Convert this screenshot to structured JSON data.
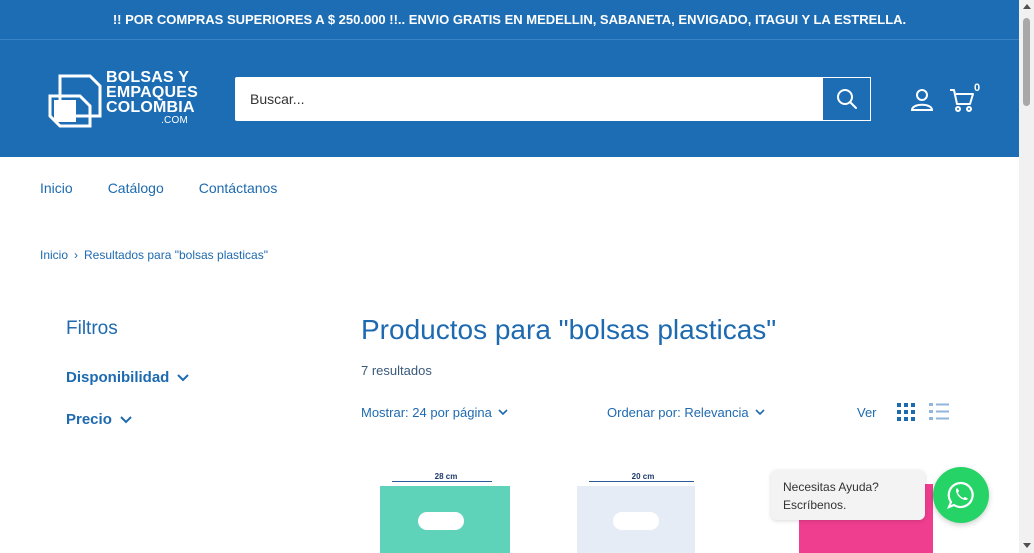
{
  "announcement": "!! POR COMPRAS SUPERIORES A $ 250.000 !!.. ENVIO GRATIS EN MEDELLIN, SABANETA, ENVIGADO, ITAGUI Y LA ESTRELLA.",
  "brand": {
    "line1": "BOLSAS Y",
    "line2": "EMPAQUES",
    "line3": "COLOMBIA",
    "suffix": ".COM"
  },
  "search": {
    "placeholder": "Buscar..."
  },
  "cart": {
    "count": "0"
  },
  "nav": [
    "Inicio",
    "Catálogo",
    "Contáctanos"
  ],
  "breadcrumb": {
    "home": "Inicio",
    "separator": "›",
    "current": "Resultados para \"bolsas plasticas\""
  },
  "filters": {
    "title": "Filtros",
    "items": [
      "Disponibilidad",
      "Precio"
    ]
  },
  "results": {
    "title": "Productos para \"bolsas plasticas\"",
    "count": "7 resultados"
  },
  "toolbar": {
    "show": "Mostrar: 24 por página",
    "sort": "Ordenar por: Relevancia",
    "view": "Ver"
  },
  "products": [
    {
      "dimension": "28 cm",
      "color": "#5fd3b9"
    },
    {
      "dimension": "20 cm",
      "color": "#e6ecf6"
    },
    {
      "dimension": "",
      "color": "#ef3e8f"
    }
  ],
  "chat": {
    "line1": "Necesitas Ayuda?",
    "line2": "Escríbenos."
  },
  "colors": {
    "primary": "#1d6db5",
    "text": "#1e6ab0",
    "whatsapp": "#25d366"
  }
}
